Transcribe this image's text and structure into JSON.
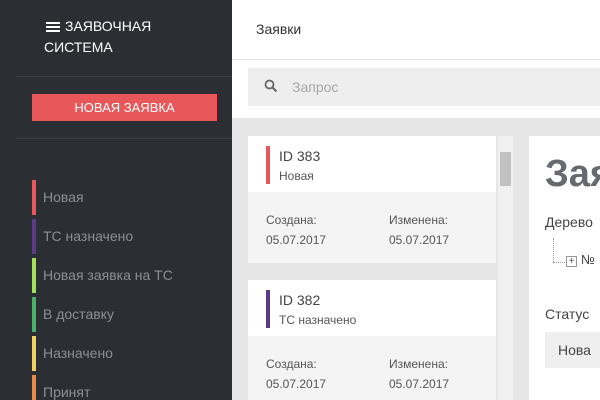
{
  "app": {
    "brand_line1": "ЗАЯВОЧНАЯ",
    "brand_line2": "СИСТЕМА",
    "new_button": "НОВАЯ ЗАЯВКА"
  },
  "sidebar": {
    "statuses": [
      {
        "label": "Новая",
        "color": "#e8585a"
      },
      {
        "label": "ТС назначено",
        "color": "#5c3a86"
      },
      {
        "label": "Новая заявка на ТС",
        "color": "#a3e05c"
      },
      {
        "label": "В доставку",
        "color": "#4caf6a"
      },
      {
        "label": "Назначено",
        "color": "#f2d063"
      },
      {
        "label": "Принят",
        "color": "#ea8a4b"
      }
    ]
  },
  "header": {
    "title": "Заявки"
  },
  "search": {
    "placeholder": "Запрос"
  },
  "tickets": [
    {
      "id": "ID 383",
      "status": "Новая",
      "color": "#e8585a",
      "created_label": "Создана:",
      "created": "05.07.2017",
      "modified_label": "Изменена:",
      "modified": "05.07.2017"
    },
    {
      "id": "ID 382",
      "status": "ТС назначено",
      "color": "#5c3a86",
      "created_label": "Создана:",
      "created": "05.07.2017",
      "modified_label": "Изменена:",
      "modified": "05.07.2017"
    }
  ],
  "detail": {
    "title": "Зая",
    "tree_label": "Дерево",
    "tree_node": "№",
    "status_label": "Статус",
    "status_value": "Нова"
  }
}
